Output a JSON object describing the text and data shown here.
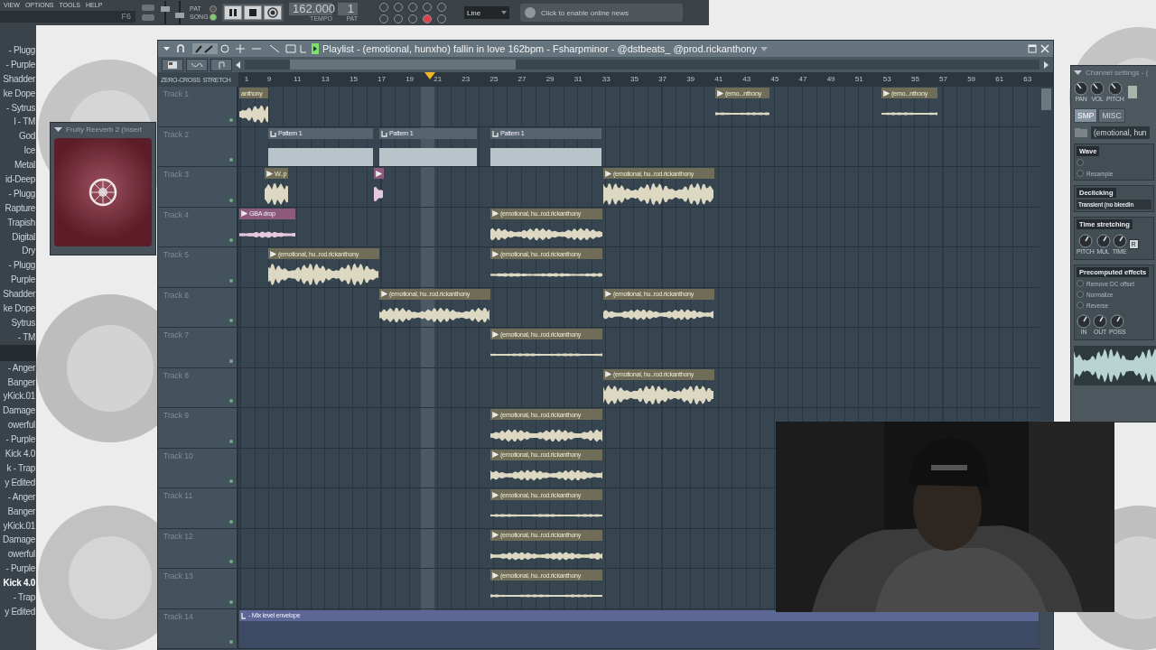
{
  "menu": [
    "VIEW",
    "OPTIONS",
    "TOOLS",
    "HELP"
  ],
  "toolbar": {
    "hint": "F6",
    "sliders": [
      {
        "level": 0.7
      },
      {
        "level": 0.35
      }
    ],
    "modes": [
      {
        "label": "PAT",
        "selected": false
      },
      {
        "label": "SONG",
        "selected": true
      }
    ],
    "tempo": "162.000",
    "tempo_label": "TEMPO",
    "pattern": "1",
    "pattern_label": "PAT",
    "toggles": [
      {
        "on": false
      },
      {
        "on": false
      },
      {
        "on": false
      },
      {
        "on": false
      },
      {
        "on": false
      },
      {
        "on": false
      },
      {
        "on": false
      },
      {
        "on": false
      },
      {
        "on": true
      },
      {
        "on": false
      }
    ],
    "snap": "Line",
    "news": "Click to enable online news"
  },
  "browser": {
    "groups": [
      [
        {
          "label": "- Plugg",
          "selected": false
        },
        {
          "label": "- Purple",
          "selected": false
        },
        {
          "label": "Shadder",
          "selected": false
        },
        {
          "label": "ke Dope",
          "selected": false
        },
        {
          "label": "- Sytrus",
          "selected": false
        },
        {
          "label": "l - TM",
          "selected": false
        },
        {
          "label": "God",
          "selected": false
        },
        {
          "label": "Ice",
          "selected": false
        },
        {
          "label": "Metal",
          "selected": false
        },
        {
          "label": "id-Deep",
          "selected": false
        },
        {
          "label": "- Plugg",
          "selected": false
        },
        {
          "label": "Rapture",
          "selected": false
        },
        {
          "label": "Trapish",
          "selected": false
        },
        {
          "label": "Digital",
          "selected": false
        },
        {
          "label": "Dry",
          "selected": false
        },
        {
          "label": "- Plugg",
          "selected": false
        },
        {
          "label": "Purple",
          "selected": false
        },
        {
          "label": "Shadder",
          "selected": false
        },
        {
          "label": "ke Dope",
          "selected": false
        },
        {
          "label": "Sytrus",
          "selected": false
        },
        {
          "label": "- TM",
          "selected": false
        }
      ],
      [
        {
          "label": "- Anger",
          "selected": false
        },
        {
          "label": "Banger",
          "selected": false
        },
        {
          "label": "yKick.01",
          "selected": false
        },
        {
          "label": "Damage",
          "selected": false
        },
        {
          "label": "owerful",
          "selected": false
        },
        {
          "label": "- Purple",
          "selected": false
        },
        {
          "label": "Kick 4.0",
          "selected": false
        },
        {
          "label": "k - Trap",
          "selected": false
        },
        {
          "label": "y Edited",
          "selected": false
        },
        {
          "label": "- Anger",
          "selected": false
        },
        {
          "label": "Banger",
          "selected": false
        },
        {
          "label": "yKick.01",
          "selected": false
        },
        {
          "label": "Damage",
          "selected": false
        },
        {
          "label": "owerful",
          "selected": false
        },
        {
          "label": "- Purple",
          "selected": false
        },
        {
          "label": "Kick 4.0",
          "selected": true
        },
        {
          "label": "- Trap",
          "selected": false
        },
        {
          "label": "y Edited",
          "selected": false
        }
      ]
    ]
  },
  "reverb": {
    "title": "Fruity Reeverb 2 (Insert"
  },
  "playlist": {
    "title": "Playlist - (emotional, hunxho) fallin in love 162bpm - Fsharpminor - @dstbeats_ @prod.rickanthony",
    "toggles": [
      "ZERO-CROSS",
      "STRETCH"
    ],
    "ruler": [
      "1",
      "9",
      "11",
      "13",
      "15",
      "17",
      "19",
      "21",
      "23",
      "25",
      "27",
      "29",
      "31",
      "33",
      "35",
      "37",
      "39",
      "41",
      "43",
      "45",
      "47",
      "49",
      "51",
      "53",
      "55",
      "57",
      "59",
      "61",
      "63"
    ],
    "tracks": [
      {
        "name": "Track 1",
        "clips": [
          {
            "kind": "audio",
            "label": "anthony",
            "marker": false
          },
          {
            "kind": "audio",
            "label": "(emo...nthony",
            "marker": true
          },
          {
            "kind": "audio",
            "label": "(emo...nthony",
            "marker": true
          }
        ]
      },
      {
        "name": "Track 2",
        "clips": [
          {
            "kind": "pattern",
            "label": "Pattern 1"
          },
          {
            "kind": "pattern",
            "label": "Pattern 1"
          },
          {
            "kind": "pattern",
            "label": "Pattern 1"
          }
        ]
      },
      {
        "name": "Track 3",
        "clips": [
          {
            "kind": "audio",
            "label": "W..p",
            "marker": true
          },
          {
            "kind": "sample",
            "marker": true
          },
          {
            "kind": "audio",
            "label": "(emotional, hu..rod.rickanthony",
            "marker": true
          }
        ]
      },
      {
        "name": "Track 4",
        "clips": [
          {
            "kind": "sample",
            "label": "GBA drop",
            "marker": true
          },
          {
            "kind": "audio",
            "label": "(emotional, hu..rod.rickanthony",
            "marker": true
          }
        ]
      },
      {
        "name": "Track 5",
        "clips": [
          {
            "kind": "audio",
            "label": "(emotional, hu..rod.rickanthony",
            "marker": true
          },
          {
            "kind": "audio",
            "label": "(emotional, hu..rod.rickanthony",
            "marker": true
          }
        ]
      },
      {
        "name": "Track 6",
        "clips": [
          {
            "kind": "audio",
            "label": "(emotional, hu..rod.rickanthony",
            "marker": true
          },
          {
            "kind": "audio",
            "label": "(emotional, hu..rod.rickanthony",
            "marker": true
          }
        ]
      },
      {
        "name": "Track 7",
        "clips": [
          {
            "kind": "audio",
            "label": "(emotional, hu..rod.rickanthony",
            "marker": true
          }
        ]
      },
      {
        "name": "Track 8",
        "clips": [
          {
            "kind": "audio",
            "label": "(emotional, hu..rod.rickanthony",
            "marker": true
          }
        ]
      },
      {
        "name": "Track 9",
        "clips": [
          {
            "kind": "audio",
            "label": "(emotional, hu..rod.rickanthony",
            "marker": true
          }
        ]
      },
      {
        "name": "Track 10",
        "clips": [
          {
            "kind": "audio",
            "label": "(emotional, hu..rod.rickanthony",
            "marker": true
          }
        ]
      },
      {
        "name": "Track 11",
        "clips": [
          {
            "kind": "audio",
            "label": "(emotional, hu..rod.rickanthony",
            "marker": true
          }
        ]
      },
      {
        "name": "Track 12",
        "clips": [
          {
            "kind": "audio",
            "label": "(emotional, hu..rod.rickanthony",
            "marker": true
          }
        ]
      },
      {
        "name": "Track 13",
        "clips": [
          {
            "kind": "audio",
            "label": "(emotional, hu..rod.rickanthony",
            "marker": true
          }
        ]
      },
      {
        "name": "Track 14",
        "clips": [
          {
            "kind": "automation",
            "label": "- Mix level envelope"
          }
        ]
      }
    ]
  },
  "channel": {
    "title": "Channel settings - (",
    "knobs": [
      "PAN",
      "VOL",
      "PITCH"
    ],
    "tabs": [
      {
        "label": "SMP",
        "selected": true
      },
      {
        "label": "MISC",
        "selected": false
      }
    ],
    "sample": "(emotional, hun",
    "sections": [
      {
        "kind": "options",
        "title": "Wave",
        "options": [
          {
            "checked": false
          },
          {
            "label": "Resample",
            "checked": false
          }
        ]
      },
      {
        "kind": "select",
        "title": "Declicking",
        "value": "Transient (no bleedin"
      },
      {
        "kind": "knobs",
        "title": "Time stretching",
        "knobs": [
          "PITCH",
          "MUL",
          "TIME"
        ],
        "button": "R"
      },
      {
        "kind": "effects",
        "title": "Precomputed effects",
        "options": [
          {
            "label": "Remove DC offset",
            "checked": false
          },
          {
            "label": "Normalize",
            "checked": false
          },
          {
            "label": "Reverse",
            "checked": false
          }
        ],
        "knobs": [
          "IN",
          "OUT",
          "POSS"
        ]
      }
    ]
  }
}
